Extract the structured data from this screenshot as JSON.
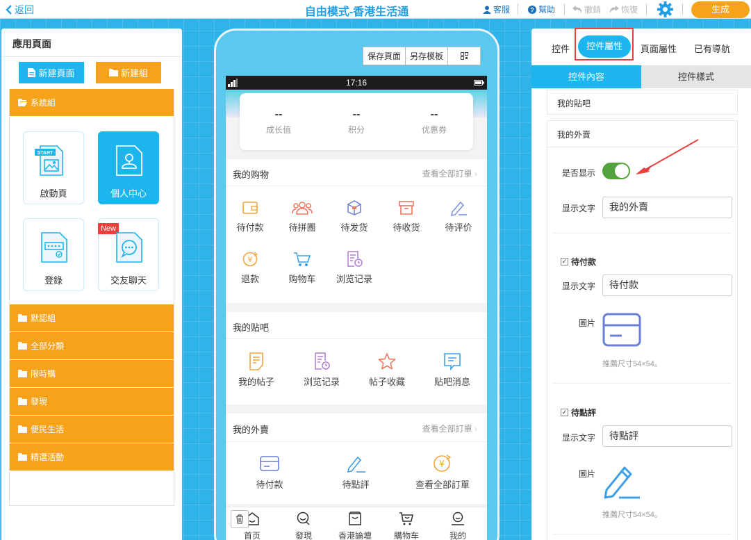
{
  "topbar": {
    "back": "返回",
    "title": "自由模式-香港生活通",
    "service": "客服",
    "help": "幫助",
    "undo": "撤銷",
    "redo": "恢復",
    "generate": "生成"
  },
  "left": {
    "title": "應用頁面",
    "new_page": "新建頁面",
    "new_group": "新建組",
    "group_system": "系統組",
    "cards": [
      {
        "label": "啟動頁",
        "icon": "start-page-icon",
        "start_badge": "START"
      },
      {
        "label": "個人中心",
        "icon": "personal-center-icon"
      },
      {
        "label": "登錄",
        "icon": "login-icon"
      },
      {
        "label": "交友聊天",
        "icon": "chat-icon",
        "badge": "New"
      }
    ],
    "groups": [
      "默認組",
      "全部分類",
      "限時購",
      "發現",
      "便民生活",
      "精選活動"
    ]
  },
  "phone": {
    "tools": [
      "保存頁面",
      "另存模板"
    ],
    "time": "17:16",
    "stats": [
      {
        "value": "--",
        "label": "成长值"
      },
      {
        "value": "--",
        "label": "积分"
      },
      {
        "value": "--",
        "label": "优惠券"
      }
    ],
    "shopping": {
      "title": "我的购物",
      "link": "查看全部訂單",
      "items": [
        "待付款",
        "待拼團",
        "待发货",
        "待收货",
        "待评价",
        "退款",
        "购物车",
        "浏览记录"
      ]
    },
    "tieba": {
      "title": "我的贴吧",
      "items": [
        "我的帖子",
        "浏览记录",
        "帖子收藏",
        "贴吧消息"
      ]
    },
    "takeout": {
      "title": "我的外賣",
      "link": "查看全部訂單",
      "items": [
        "待付款",
        "待點評",
        "查看全部訂單"
      ]
    },
    "tabbar": [
      "首页",
      "發現",
      "香港論壇",
      "購物车",
      "我的"
    ]
  },
  "right": {
    "tabs": [
      "控件",
      "控件屬性",
      "頁面屬性",
      "已有導航"
    ],
    "subtabs": [
      "控件內容",
      "控件樣式"
    ],
    "tieba_header": "我的貼吧",
    "takeout_header": "我的外賣",
    "show_label": "是否显示",
    "show_on": true,
    "text_label": "显示文字",
    "text_value": "我的外賣",
    "item1_check": "待付款",
    "item1_text": "待付款",
    "image_label": "圖片",
    "hint": "推薦尺寸54×54。",
    "item2_check": "待點評",
    "item2_text": "待點評"
  },
  "colors": {
    "accent": "#1eb4ee",
    "orange": "#f7a21b",
    "red": "#e8403c",
    "toggle": "#52a33b"
  }
}
